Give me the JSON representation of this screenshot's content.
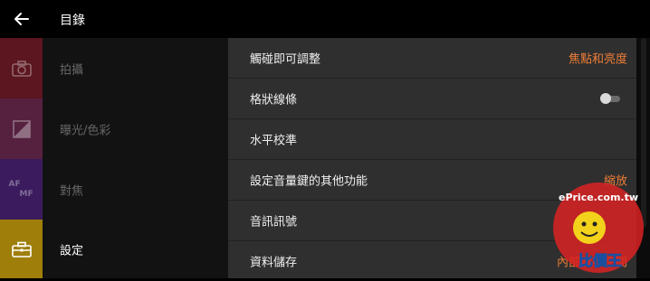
{
  "header": {
    "title": "目錄",
    "back_icon": "arrow-left-icon"
  },
  "sidebar": {
    "items": [
      {
        "label": "拍攝",
        "icon": "camera-icon",
        "color": "#5b1620",
        "active": false
      },
      {
        "label": "曝光/色彩",
        "icon": "exposure-icon",
        "color": "#55213f",
        "active": false
      },
      {
        "label": "對焦",
        "icon": "af-mf-icon",
        "icon_text_top": "AF",
        "icon_text_bottom": "MF",
        "color": "#3b1b5e",
        "active": false
      },
      {
        "label": "設定",
        "icon": "toolbox-icon",
        "color": "#9f7e0a",
        "active": true
      }
    ]
  },
  "settings": {
    "rows": [
      {
        "label": "觸碰即可調整",
        "value": "焦點和亮度"
      },
      {
        "label": "格狀線條",
        "toggle": false
      },
      {
        "label": "水平校準"
      },
      {
        "label": "設定音量鍵的其他功能",
        "value": "縮放"
      },
      {
        "label": "音訊訊號"
      },
      {
        "label": "資料儲存",
        "value": "內部儲存空間"
      }
    ]
  },
  "colors": {
    "accent": "#ee7d37",
    "panel": "#2f2f2f"
  },
  "watermark": {
    "top_text": "ePrice.com.tw",
    "badge_text": "比價王"
  }
}
